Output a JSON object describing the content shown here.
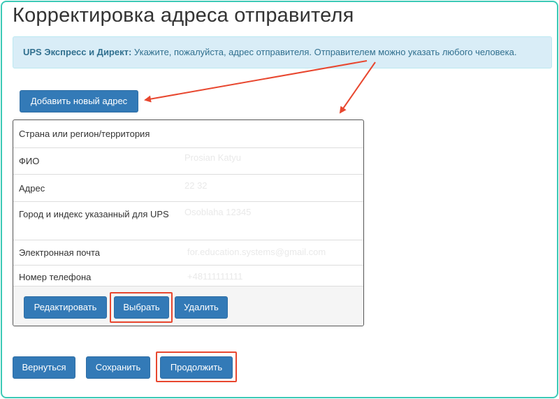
{
  "page": {
    "title": "Корректировка адреса отправителя"
  },
  "alert": {
    "strong": "UPS Экспресс и Директ:",
    "text": " Укажите, пожалуйста, адрес отправителя. Отправителем можно указать любого человека."
  },
  "buttons": {
    "add_address": "Добавить новый адрес",
    "edit": "Редактировать",
    "select": "Выбрать",
    "delete": "Удалить",
    "back": "Вернуться",
    "save": "Сохранить",
    "continue": "Продолжить"
  },
  "address_card": {
    "rows": [
      {
        "label": "Страна или регион/территория",
        "value": ""
      },
      {
        "label": "ФИО",
        "value": "Prosian Katyu"
      },
      {
        "label": "Адрес",
        "value": "22 32"
      },
      {
        "label": "Город и индекс указанный для UPS",
        "value": "Osoblaha 12345"
      },
      {
        "label": "Электронная почта",
        "value": "for.education.systems@gmail.com"
      },
      {
        "label": "Номер телефона",
        "value": "+48111111111"
      }
    ]
  },
  "colors": {
    "primary": "#337ab7",
    "alert_bg": "#d9edf7",
    "alert_text": "#31708f",
    "annotation": "#e8472f",
    "frame": "#3cc9b6"
  }
}
